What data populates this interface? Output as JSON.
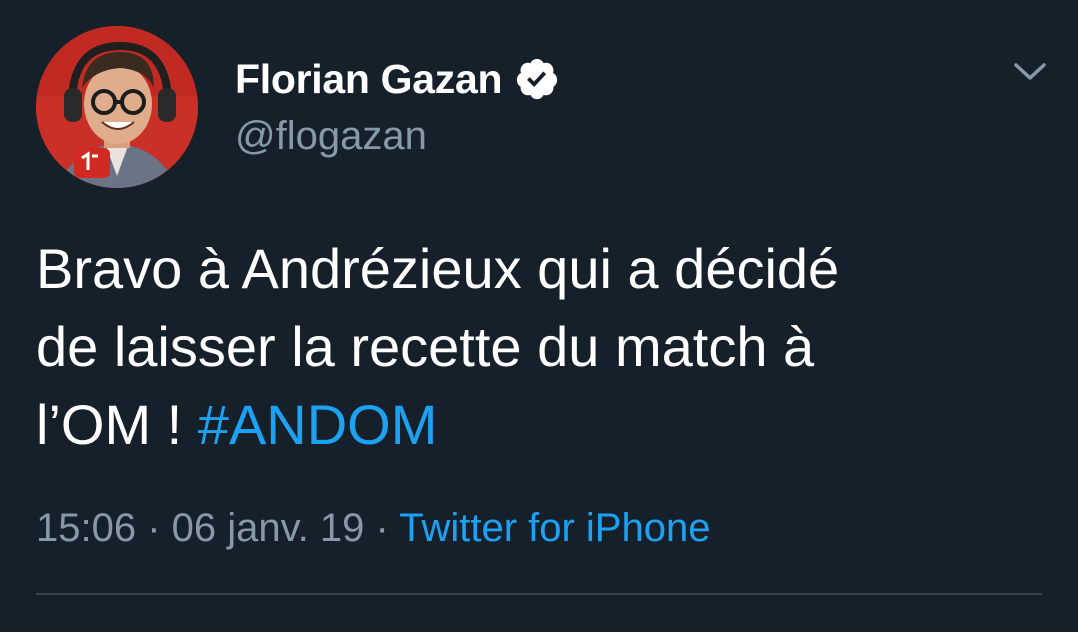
{
  "tweet": {
    "author": {
      "display_name": "Florian Gazan",
      "handle": "@flogazan",
      "verified": true
    },
    "text": {
      "line1": "Bravo à Andrézieux qui a décidé",
      "line2": "de laisser la recette du match à",
      "line3_prefix": "l’OM ! ",
      "hashtag": "#ANDOM"
    },
    "meta": {
      "time": "15:06",
      "separator1": " · ",
      "date": "06 janv. 19",
      "separator2": " · ",
      "source": "Twitter for iPhone"
    }
  },
  "icons": {
    "verified": "verified-badge-icon",
    "menu": "chevron-down-icon"
  },
  "colors": {
    "background": "#15202b",
    "text_primary": "#ffffff",
    "text_secondary": "#8899a6",
    "accent": "#1da1f2",
    "divider": "#38444d"
  }
}
